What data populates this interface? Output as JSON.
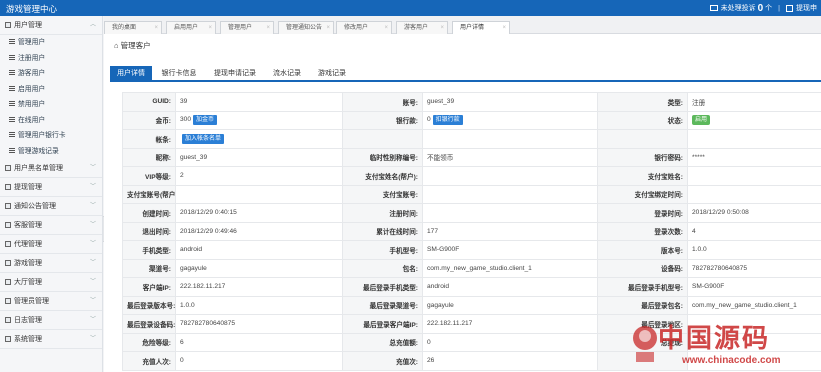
{
  "app": {
    "title": "游戏管理中心"
  },
  "topbar": {
    "pending_label": "未处理投诉",
    "pending_count": "0",
    "pending_unit": "个",
    "separator": "|",
    "help_label": "提现申"
  },
  "sidebar": {
    "groups": [
      {
        "label": "用户管理",
        "items": [
          "管理用户",
          "注册用户",
          "游客用户",
          "启用用户",
          "禁用用户",
          "在线用户",
          "管理用户银行卡",
          "管理游戏记录"
        ]
      },
      {
        "label": "用户黑名单管理"
      },
      {
        "label": "提现管理"
      },
      {
        "label": "通知公告管理"
      },
      {
        "label": "客服管理"
      },
      {
        "label": "代理管理"
      },
      {
        "label": "游戏管理"
      },
      {
        "label": "大厅管理"
      },
      {
        "label": "管理员管理"
      },
      {
        "label": "日志管理"
      },
      {
        "label": "系统管理"
      }
    ]
  },
  "tabs": [
    "我的桌面",
    "启用用户",
    "管理用户",
    "管理通知公告",
    "修改用户",
    "游客用户",
    "用户详情"
  ],
  "breadcrumb": "管理客户",
  "subtabs": [
    "用户详情",
    "银行卡信息",
    "提现申请记录",
    "流水记录",
    "游戏记录"
  ],
  "detail_rows": [
    [
      [
        "GUID:",
        "39"
      ],
      [
        "账号:",
        "guest_39"
      ],
      [
        "类型:",
        "注册"
      ]
    ],
    [
      [
        "金币:",
        "300",
        "加金币"
      ],
      [
        "银行款:",
        "0",
        "扣银行款"
      ],
      [
        "状态:",
        "",
        "启用"
      ]
    ],
    [
      [
        "帐条:",
        "",
        "加入帐条名单"
      ],
      [
        "",
        ""
      ],
      [
        "",
        ""
      ]
    ],
    [
      [
        "昵称:",
        "guest_39"
      ],
      [
        "临时性别称编号:",
        "不能领币"
      ],
      [
        "银行密码:",
        "*****"
      ]
    ],
    [
      [
        "VIP等级:",
        "2"
      ],
      [
        "支付宝姓名(帮户):",
        ""
      ],
      [
        "支付宝姓名:",
        ""
      ]
    ],
    [
      [
        "支付宝账号(帮户):",
        ""
      ],
      [
        "支付宝账号:",
        ""
      ],
      [
        "支付宝绑定时间:",
        ""
      ]
    ],
    [
      [
        "创建时间:",
        "2018/12/29 0:40:15"
      ],
      [
        "注册时间:",
        ""
      ],
      [
        "登录时间:",
        "2018/12/29 0:50:08"
      ]
    ],
    [
      [
        "退出时间:",
        "2018/12/29 0:49:46"
      ],
      [
        "累计在线时间:",
        "177"
      ],
      [
        "登录次数:",
        "4"
      ]
    ],
    [
      [
        "手机类型:",
        "android"
      ],
      [
        "手机型号:",
        "SM-G900F"
      ],
      [
        "版本号:",
        "1.0.0"
      ]
    ],
    [
      [
        "渠道号:",
        "gagayule"
      ],
      [
        "包名:",
        "com.my_new_game_studio.client_1"
      ],
      [
        "设备码:",
        "782782780640875"
      ]
    ],
    [
      [
        "客户端IP:",
        "222.182.11.217"
      ],
      [
        "最后登录手机类型:",
        "android"
      ],
      [
        "最后登录手机型号:",
        "SM-G900F"
      ]
    ],
    [
      [
        "最后登录版本号:",
        "1.0.0"
      ],
      [
        "最后登录渠道号:",
        "gagayule"
      ],
      [
        "最后登录包名:",
        "com.my_new_game_studio.client_1"
      ]
    ],
    [
      [
        "最后登录设备码:",
        "782782780640875"
      ],
      [
        "最后登录客户端IP:",
        "222.182.11.217"
      ],
      [
        "最后登录地区:",
        ""
      ]
    ],
    [
      [
        "危险等级:",
        "6"
      ],
      [
        "总充值额:",
        "0"
      ],
      [
        "总提现:",
        ""
      ]
    ],
    [
      [
        "充值人次:",
        "0"
      ],
      [
        "充值次:",
        "26"
      ],
      [
        "",
        ""
      ]
    ]
  ],
  "watermark": {
    "text": "中国源码",
    "url": "www.chinacode.com"
  },
  "colors": {
    "primary": "#1666b8",
    "button": "#2b7fd6",
    "status_green": "#5cb85c",
    "watermark": "#c82828"
  }
}
